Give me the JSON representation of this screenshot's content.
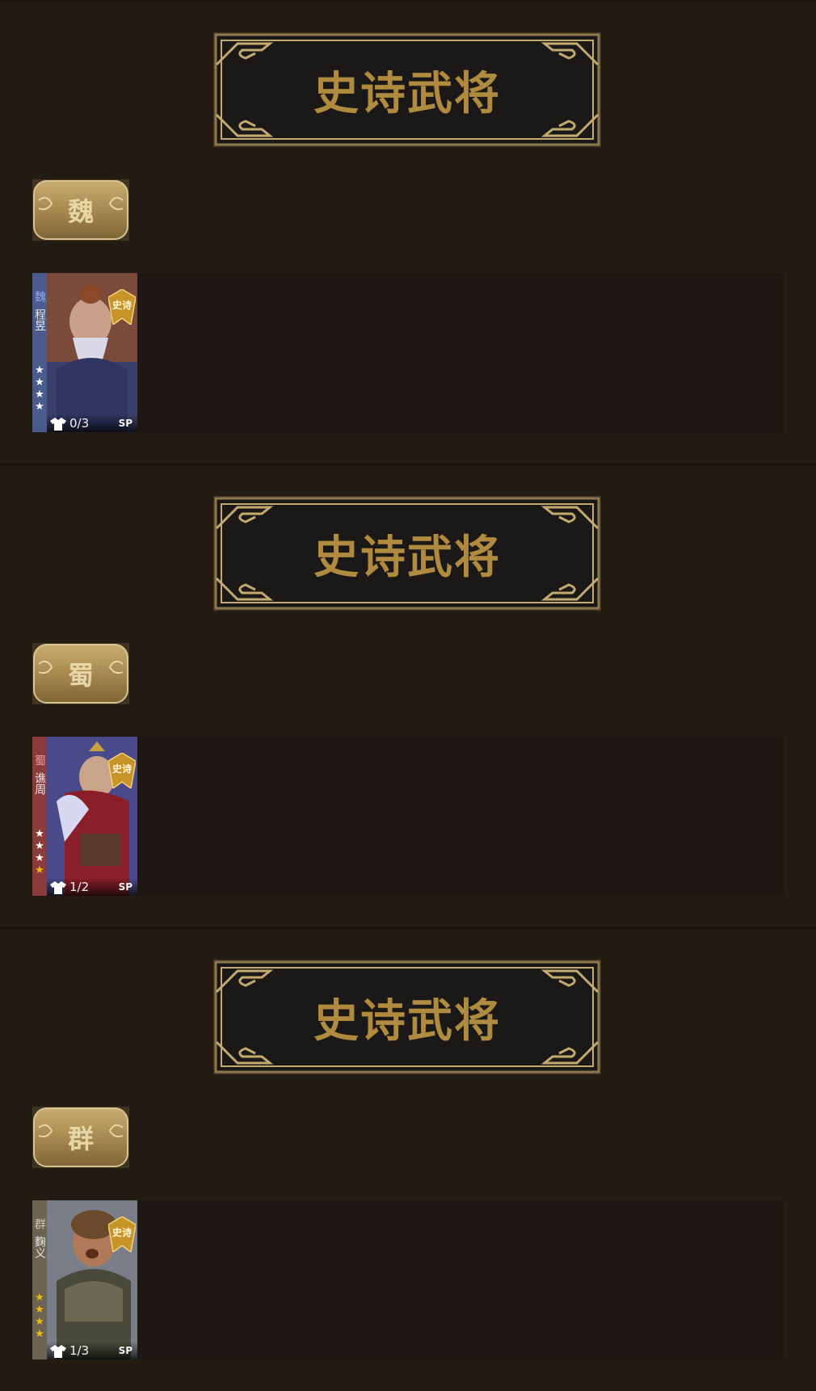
{
  "sections": [
    {
      "title": "史诗武将",
      "faction": "魏",
      "card": {
        "faction": "魏",
        "name": "程昱",
        "badge_text": "史诗",
        "skins": "0/3",
        "tag": "SP",
        "stars_total": 4,
        "stars_gold": 0,
        "strip_color": "#4a5c8e",
        "faction_color": "#8ea6e8"
      }
    },
    {
      "title": "史诗武将",
      "faction": "蜀",
      "card": {
        "faction": "蜀",
        "name": "谯周",
        "badge_text": "史诗",
        "skins": "1/2",
        "tag": "SP",
        "stars_total": 4,
        "stars_gold": 1,
        "strip_color": "#8a3c3c",
        "faction_color": "#e89a9a"
      }
    },
    {
      "title": "史诗武将",
      "faction": "群",
      "card": {
        "faction": "群",
        "name": "麴义",
        "badge_text": "史诗",
        "skins": "1/3",
        "tag": "SP",
        "stars_total": 4,
        "stars_gold": 4,
        "strip_color": "#6b6453",
        "faction_color": "#cfc6a8"
      }
    }
  ],
  "colors": {
    "page_bg": "#241b12",
    "gold": "#b08a3f",
    "row_bg": "#1e1612",
    "star_gold": "#f0b90b",
    "star_white": "#ffffff"
  },
  "icons": {
    "shirt": "shirt-icon",
    "badge": "epic-badge-icon"
  }
}
